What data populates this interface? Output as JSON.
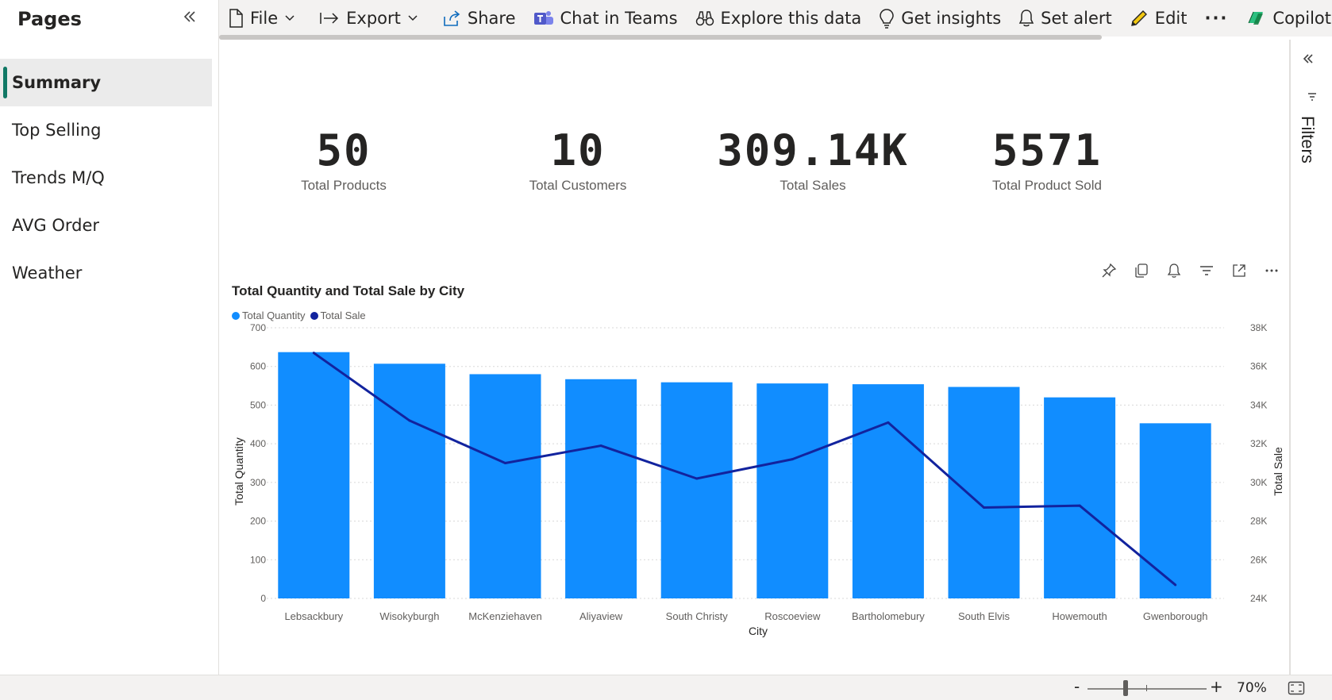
{
  "sidebar": {
    "title": "Pages",
    "items": [
      {
        "label": "Summary",
        "active": true
      },
      {
        "label": "Top Selling"
      },
      {
        "label": "Trends M/Q"
      },
      {
        "label": "AVG Order"
      },
      {
        "label": "Weather"
      }
    ]
  },
  "toolbar": {
    "file": "File",
    "export": "Export",
    "share": "Share",
    "chat": "Chat in Teams",
    "explore": "Explore this data",
    "insights": "Get insights",
    "alert": "Set alert",
    "edit": "Edit",
    "more": "···",
    "copilot": "Copilot"
  },
  "kpis": [
    {
      "value": "50",
      "label": "Total Products"
    },
    {
      "value": "10",
      "label": "Total Customers"
    },
    {
      "value": "309.14K",
      "label": "Total Sales"
    },
    {
      "value": "5571",
      "label": "Total Product Sold"
    }
  ],
  "filters": {
    "label": "Filters"
  },
  "zoom": {
    "minus": "-",
    "plus": "+",
    "level": "70%"
  },
  "colors": {
    "bar": "#118DFF",
    "line": "#12239E",
    "accent": "#117865"
  },
  "chart_data": {
    "type": "bar",
    "title": "Total Quantity and Total Sale by City",
    "xlabel": "City",
    "ylabel": "Total Quantity",
    "y2label": "Total Sale",
    "categories": [
      "Lebsackbury",
      "Wisokyburgh",
      "McKenziehaven",
      "Aliyaview",
      "South Christy",
      "Roscoeview",
      "Bartholomebury",
      "South Elvis",
      "Howemouth",
      "Gwenborough"
    ],
    "series": [
      {
        "name": "Total Quantity",
        "type": "bar",
        "axis": "left",
        "color": "#118DFF",
        "values": [
          637,
          607,
          580,
          567,
          559,
          556,
          554,
          547,
          520,
          453
        ]
      },
      {
        "name": "Total Sale",
        "type": "line",
        "axis": "right",
        "color": "#12239E",
        "values": [
          36700,
          33200,
          31000,
          31900,
          30200,
          31200,
          33100,
          28700,
          28800,
          24700
        ]
      }
    ],
    "ylim": [
      0,
      700
    ],
    "y2lim": [
      24000,
      38000
    ],
    "yticks": [
      "0",
      "100",
      "200",
      "300",
      "400",
      "500",
      "600",
      "700"
    ],
    "y2ticks": [
      "24K",
      "26K",
      "28K",
      "30K",
      "32K",
      "34K",
      "36K",
      "38K"
    ],
    "grid": true,
    "legend": "top-left"
  }
}
